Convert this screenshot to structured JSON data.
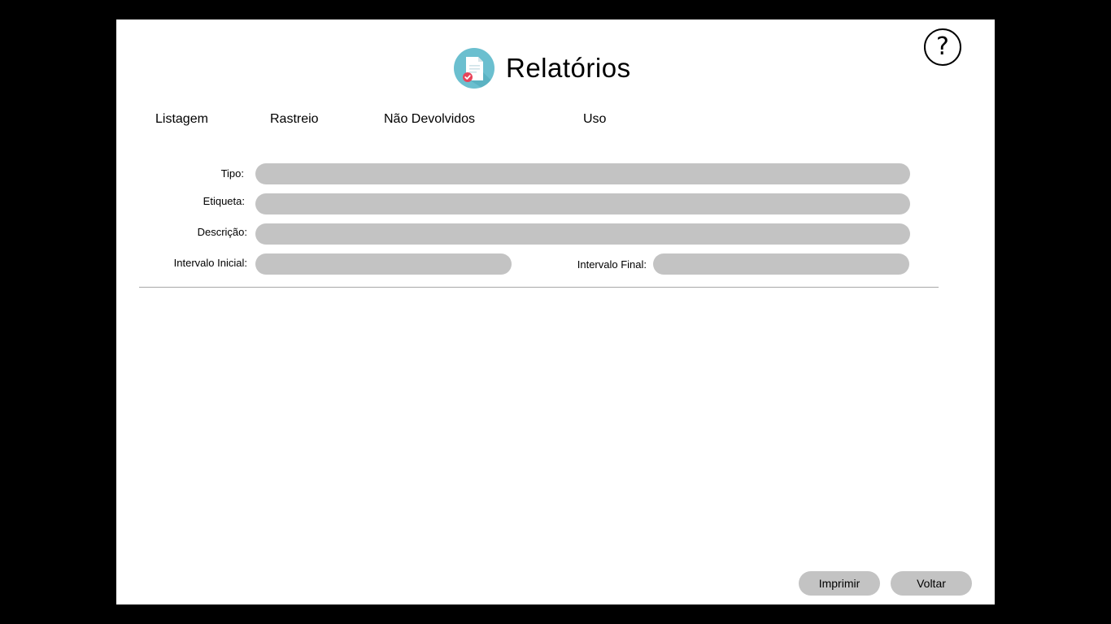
{
  "page": {
    "title": "Relatórios",
    "help_symbol": "?",
    "help_icon": "question-circle-icon",
    "logo_icon": "report-document-icon"
  },
  "tabs": [
    {
      "label": "Listagem"
    },
    {
      "label": "Rastreio"
    },
    {
      "label": "Não Devolvidos"
    },
    {
      "label": "Uso"
    }
  ],
  "form": {
    "tipo": {
      "label": "Tipo:",
      "value": ""
    },
    "etiqueta": {
      "label": "Etiqueta:",
      "value": ""
    },
    "descricao": {
      "label": "Descrição:",
      "value": ""
    },
    "intervalo_inicial": {
      "label": "Intervalo Inicial:",
      "value": ""
    },
    "intervalo_final": {
      "label": "Intervalo Final:",
      "value": ""
    }
  },
  "actions": {
    "print_label": "Imprimir",
    "back_label": "Voltar"
  },
  "colors": {
    "field_background": "#c3c3c3",
    "logo_circle": "#6bbfcf",
    "logo_check": "#e8445a",
    "window_background": "#ffffff",
    "screen_background": "#000000"
  }
}
